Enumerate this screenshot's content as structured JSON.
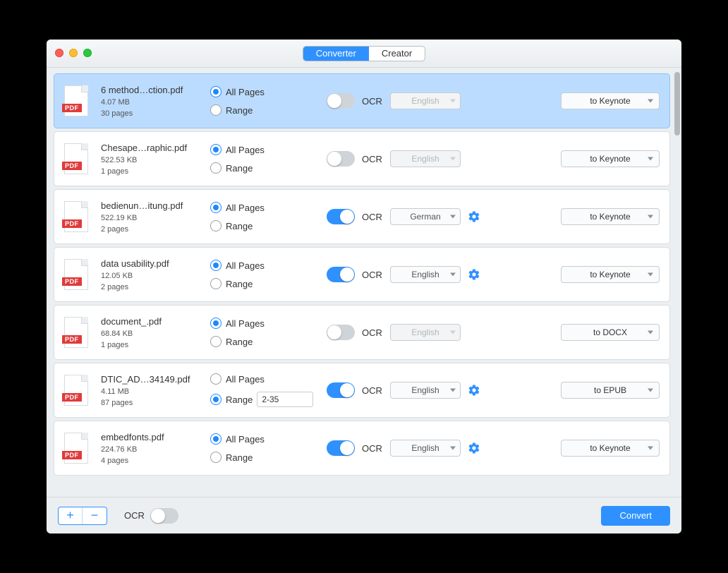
{
  "tabs": {
    "converter": "Converter",
    "creator": "Creator"
  },
  "radio_labels": {
    "all": "All Pages",
    "range": "Range"
  },
  "ocr_label": "OCR",
  "pdf_badge": "PDF",
  "footer": {
    "ocr_label": "OCR",
    "convert": "Convert",
    "add": "+",
    "remove": "−"
  },
  "files": [
    {
      "name": "6 method…ction.pdf",
      "size": "4.07 MB",
      "pages": "30 pages",
      "page_mode": "all",
      "range_value": "",
      "ocr_on": false,
      "lang": "English",
      "output": "to Keynote",
      "selected": true
    },
    {
      "name": "Chesape…raphic.pdf",
      "size": "522.53 KB",
      "pages": "1 pages",
      "page_mode": "all",
      "range_value": "",
      "ocr_on": false,
      "lang": "English",
      "output": "to Keynote",
      "selected": false
    },
    {
      "name": "bedienun…itung.pdf",
      "size": "522.19 KB",
      "pages": "2 pages",
      "page_mode": "all",
      "range_value": "",
      "ocr_on": true,
      "lang": "German",
      "output": "to Keynote",
      "selected": false
    },
    {
      "name": "data usability.pdf",
      "size": "12.05 KB",
      "pages": "2 pages",
      "page_mode": "all",
      "range_value": "",
      "ocr_on": true,
      "lang": "English",
      "output": "to Keynote",
      "selected": false
    },
    {
      "name": "document_.pdf",
      "size": "68.84 KB",
      "pages": "1 pages",
      "page_mode": "all",
      "range_value": "",
      "ocr_on": false,
      "lang": "English",
      "output": "to DOCX",
      "selected": false
    },
    {
      "name": "DTIC_AD…34149.pdf",
      "size": "4.11 MB",
      "pages": "87 pages",
      "page_mode": "range",
      "range_value": "2-35",
      "ocr_on": true,
      "lang": "English",
      "output": "to EPUB",
      "selected": false
    },
    {
      "name": "embedfonts.pdf",
      "size": "224.76 KB",
      "pages": "4 pages",
      "page_mode": "all",
      "range_value": "",
      "ocr_on": true,
      "lang": "English",
      "output": "to Keynote",
      "selected": false
    }
  ]
}
